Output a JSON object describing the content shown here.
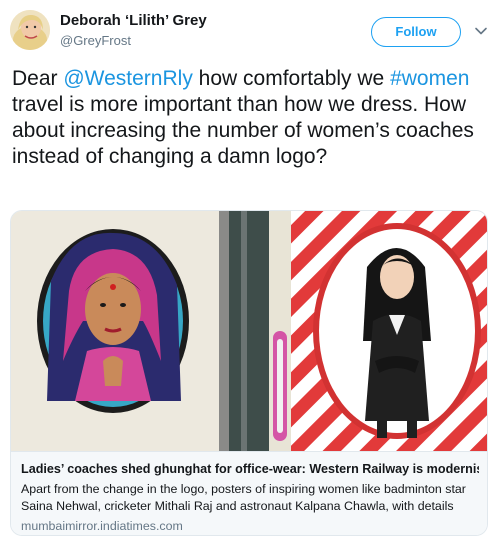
{
  "author": {
    "name": "Deborah ‘Lilith’ Grey",
    "handle": "@GreyFrost"
  },
  "follow_label": "Follow",
  "tweet": {
    "text_1": "Dear ",
    "mention": "@WesternRly",
    "text_2": " how comfortably we ",
    "hashtag": "#women",
    "text_3": " travel is more important than how we dress. How about increasing the number of women’s coaches instead of changing a damn logo?"
  },
  "card": {
    "title": "Ladies’ coaches shed ghunghat for office-wear: Western Railway is modernisin...",
    "description": "Apart from the change in the logo, posters of inspiring women like badminton star Saina Nehwal, cricketer Mithali Raj and astronaut Kalpana Chawla, with details",
    "domain": "mumbaimirror.indiatimes.com"
  },
  "colors": {
    "link": "#1b95e0",
    "follow": "#1da1f2",
    "text": "#14171a",
    "muted": "#657786"
  },
  "icons": {
    "caret": "chevron-down-icon"
  }
}
